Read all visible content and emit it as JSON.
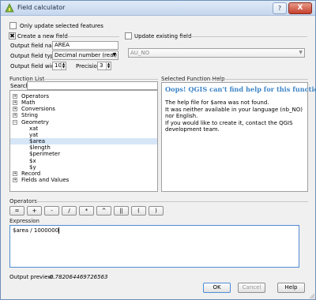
{
  "window": {
    "title": "Field calculator",
    "help_glyph": "?",
    "close_glyph": "X"
  },
  "only_selected": {
    "label": "Only update selected features",
    "checked": false
  },
  "create_new": {
    "label": "Create a new field",
    "check_glyph": "✖",
    "name_label": "Output field name",
    "name_value": "AREA",
    "type_label": "Output field type",
    "type_value": "Decimal number (real)",
    "width_label": "Output field width",
    "width_value": "10",
    "precision_label": "Precision",
    "precision_value": "3"
  },
  "update_existing": {
    "label": "Update existing field",
    "field_value": "AU_NO"
  },
  "function_list": {
    "title": "Function List",
    "search_label": "Search",
    "tree": [
      {
        "label": "Operators",
        "expander": "+",
        "level": 0
      },
      {
        "label": "Math",
        "expander": "+",
        "level": 0
      },
      {
        "label": "Conversions",
        "expander": "+",
        "level": 0
      },
      {
        "label": "String",
        "expander": "+",
        "level": 0
      },
      {
        "label": "Geometry",
        "expander": "−",
        "level": 0
      },
      {
        "label": "xat",
        "expander": "",
        "level": 1
      },
      {
        "label": "yat",
        "expander": "",
        "level": 1
      },
      {
        "label": "$area",
        "expander": "",
        "level": 1,
        "selected": true
      },
      {
        "label": "$length",
        "expander": "",
        "level": 1
      },
      {
        "label": "$perimeter",
        "expander": "",
        "level": 1
      },
      {
        "label": "$x",
        "expander": "",
        "level": 1
      },
      {
        "label": "$y",
        "expander": "",
        "level": 1
      },
      {
        "label": "Record",
        "expander": "+",
        "level": 0
      },
      {
        "label": "Fields and Values",
        "expander": "+",
        "level": 0
      }
    ]
  },
  "function_help": {
    "title": "Selected Function Help",
    "heading": "Oops! QGIS can't find help for this function.",
    "line1": "The help file for $area was not found.",
    "line2": "It was neither available in your language (nb_NO) nor English.",
    "line3": "If you would like to create it, contact the QGIS development team."
  },
  "operators": {
    "title": "Operators",
    "buttons": [
      "=",
      "+",
      "-",
      "/",
      "*",
      "^",
      "||",
      "(",
      ")"
    ]
  },
  "expression": {
    "title": "Expression",
    "value": "$area / 1000000"
  },
  "preview": {
    "label": "Output preview:",
    "value": "0.782064469726563"
  },
  "buttons": {
    "ok": "OK",
    "cancel": "Cancel",
    "help": "Help"
  },
  "colors": {
    "titlebar": "#c5d6ee",
    "help_heading": "#3f86c8",
    "close": "#c5402c",
    "focus": "#4f8cd4"
  }
}
